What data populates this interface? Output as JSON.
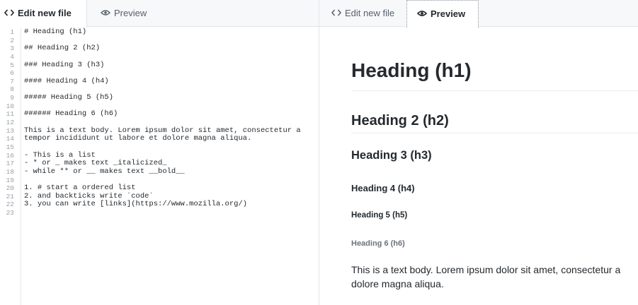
{
  "left_pane": {
    "tabs": {
      "edit": "Edit new file",
      "preview": "Preview"
    },
    "lines": [
      {
        "n": "1",
        "t": "# Heading (h1)"
      },
      {
        "n": "2",
        "t": ""
      },
      {
        "n": "3",
        "t": "## Heading 2 (h2)"
      },
      {
        "n": "4",
        "t": ""
      },
      {
        "n": "5",
        "t": "### Heading 3 (h3)"
      },
      {
        "n": "6",
        "t": ""
      },
      {
        "n": "7",
        "t": "#### Heading 4 (h4)"
      },
      {
        "n": "8",
        "t": ""
      },
      {
        "n": "9",
        "t": "##### Heading 5 (h5)"
      },
      {
        "n": "10",
        "t": ""
      },
      {
        "n": "11",
        "t": "###### Heading 6 (h6)"
      },
      {
        "n": "12",
        "t": ""
      },
      {
        "n": "13",
        "t": "This is a text body. Lorem ipsum dolor sit amet, consectetur a"
      },
      {
        "n": "14",
        "t": "tempor incididunt ut labore et dolore magna aliqua."
      },
      {
        "n": "15",
        "t": ""
      },
      {
        "n": "16",
        "t": "- This is a list"
      },
      {
        "n": "17",
        "t": "- * or _ makes text _italicized_"
      },
      {
        "n": "18",
        "t": "- while ** or __ makes text __bold__"
      },
      {
        "n": "19",
        "t": ""
      },
      {
        "n": "20",
        "t": "1. # start a ordered list"
      },
      {
        "n": "21",
        "t": "2. and backticks write `code`"
      },
      {
        "n": "22",
        "t": "3. you can write [links](https://www.mozilla.org/)"
      },
      {
        "n": "23",
        "t": ""
      }
    ]
  },
  "right_pane": {
    "tabs": {
      "edit": "Edit new file",
      "preview": "Preview"
    },
    "preview": {
      "h1": "Heading (h1)",
      "h2": "Heading 2 (h2)",
      "h3": "Heading 3 (h3)",
      "h4": "Heading 4 (h4)",
      "h5": "Heading 5 (h5)",
      "h6": "Heading 6 (h6)",
      "paragraph_line1": "This is a text body. Lorem ipsum dolor sit amet, consectetur a",
      "paragraph_line2": "dolore magna aliqua."
    }
  },
  "icons": {
    "edit_tab": "code-icon",
    "preview_tab": "eye-icon"
  }
}
